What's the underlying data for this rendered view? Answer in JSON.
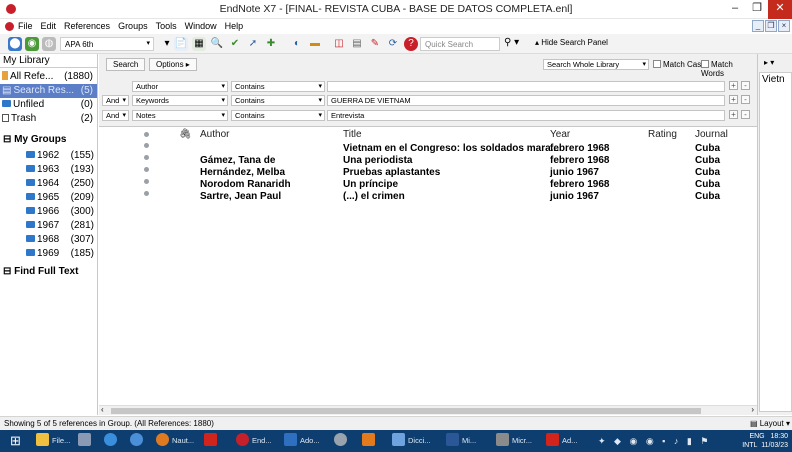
{
  "window": {
    "title": "EndNote X7 - [FINAL- REVISTA CUBA - BASE DE DATOS COMPLETA.enl]",
    "minimize": "–",
    "maximize": "❐",
    "close": "✕"
  },
  "menu": [
    "File",
    "Edit",
    "References",
    "Groups",
    "Tools",
    "Window",
    "Help"
  ],
  "mdi_buttons": [
    "_",
    "❐",
    "×"
  ],
  "toolbar": {
    "style": "APA 6th",
    "quick_search_placeholder": "Quick Search",
    "hide_panel": "Hide Search Panel",
    "search_icon": "search-icon"
  },
  "sidebar": {
    "library": "My Library",
    "items": [
      {
        "label": "All Refe...",
        "count": "(1880)"
      },
      {
        "label": "Search Res...",
        "count": "(5)"
      },
      {
        "label": "Unfiled",
        "count": "(0)"
      },
      {
        "label": "Trash",
        "count": "(2)"
      }
    ],
    "my_groups": "My Groups",
    "groups": [
      {
        "label": "1962",
        "count": "(155)"
      },
      {
        "label": "1963",
        "count": "(193)"
      },
      {
        "label": "1964",
        "count": "(250)"
      },
      {
        "label": "1965",
        "count": "(209)"
      },
      {
        "label": "1966",
        "count": "(300)"
      },
      {
        "label": "1967",
        "count": "(281)"
      },
      {
        "label": "1968",
        "count": "(307)"
      },
      {
        "label": "1969",
        "count": "(185)"
      }
    ],
    "find_full_text": "Find Full Text"
  },
  "search_panel": {
    "search_btn": "Search",
    "options_btn": "Options ▸",
    "scope": "Search Whole Library",
    "match_case": "Match Case",
    "match_words": "Match Words",
    "rows": [
      {
        "bool": "",
        "field": "Author",
        "op": "Contains",
        "value": ""
      },
      {
        "bool": "And",
        "field": "Keywords",
        "op": "Contains",
        "value": "GUERRA DE VIETNAM"
      },
      {
        "bool": "And",
        "field": "Notes",
        "op": "Contains",
        "value": "Entrevista"
      }
    ]
  },
  "columns": {
    "author": "Author",
    "title": "Title",
    "year": "Year",
    "rating": "Rating",
    "journal": "Journal"
  },
  "references": [
    {
      "author": "",
      "title": "Vietnam en el Congreso: los soldados mara...",
      "year": "febrero 1968",
      "journal": "Cuba"
    },
    {
      "author": "Gámez, Tana de",
      "title": "Una periodista",
      "year": "febrero 1968",
      "journal": "Cuba"
    },
    {
      "author": "Hernández, Melba",
      "title": "Pruebas aplastantes",
      "year": "junio 1967",
      "journal": "Cuba"
    },
    {
      "author": "Norodom Ranaridh",
      "title": "Un príncipe",
      "year": "febrero 1968",
      "journal": "Cuba"
    },
    {
      "author": "Sartre, Jean Paul",
      "title": "(...) el crimen",
      "year": "junio 1967",
      "journal": "Cuba"
    }
  ],
  "right_panel": {
    "field_text": "Vietn"
  },
  "status": {
    "text": "Showing 5 of 5 references in Group. (All References: 1880)",
    "layout": "Layout"
  },
  "taskbar": {
    "items": [
      "File...",
      "Naut...",
      "End...",
      "Ado...",
      "Dicci...",
      "Mi...",
      "Micr...",
      "Ad..."
    ],
    "lang": "ENG",
    "region": "INTL",
    "time": "18:30",
    "date": "11/03/23"
  }
}
